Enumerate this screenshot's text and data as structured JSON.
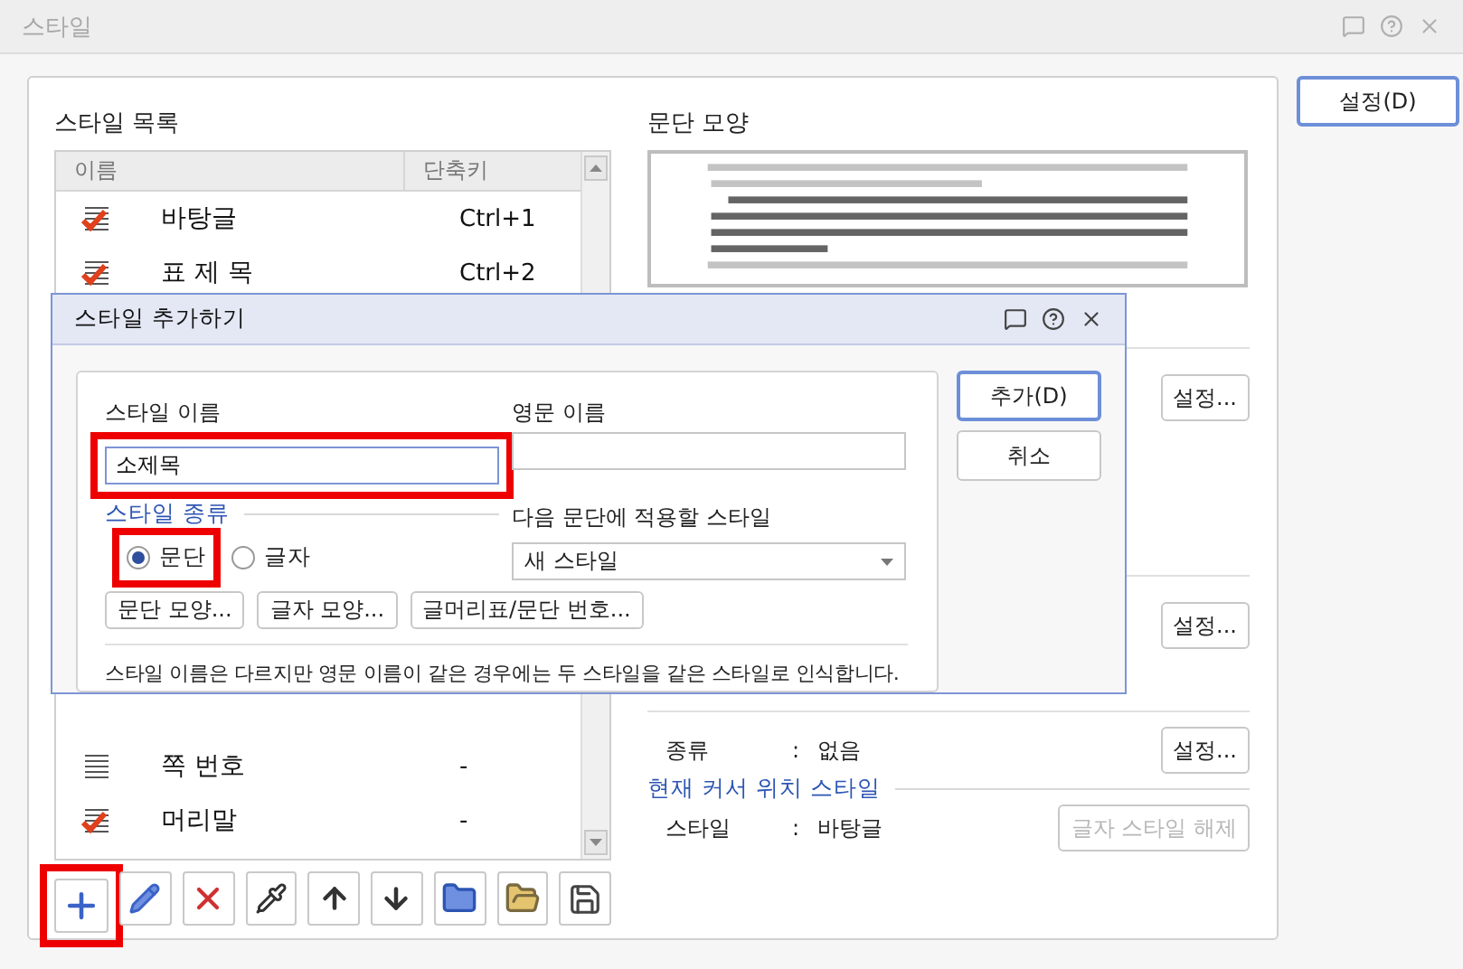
{
  "window": {
    "title": "스타일",
    "setup_button": "설정(D)"
  },
  "style_list": {
    "title": "스타일 목록",
    "columns": [
      "이름",
      "단축키"
    ],
    "rows": [
      {
        "kind": "paragraph",
        "name": "바탕글",
        "shortcut": "Ctrl+1"
      },
      {
        "kind": "paragraph",
        "name": "표 제 목",
        "shortcut": "Ctrl+2"
      }
    ],
    "rows_lower": [
      {
        "kind": "character",
        "name": "쪽 번호",
        "shortcut": "-"
      },
      {
        "kind": "paragraph",
        "name": "머리말",
        "shortcut": "-"
      }
    ]
  },
  "toolbar": [
    {
      "kind": "add",
      "highlighted": true
    },
    {
      "kind": "edit",
      "highlighted": false
    },
    {
      "kind": "delete",
      "highlighted": false
    },
    {
      "kind": "picker",
      "highlighted": false
    },
    {
      "kind": "up",
      "highlighted": false
    },
    {
      "kind": "down",
      "highlighted": false
    },
    {
      "kind": "import",
      "highlighted": false
    },
    {
      "kind": "open",
      "highlighted": false
    },
    {
      "kind": "save",
      "highlighted": false
    }
  ],
  "paragraph_shape": {
    "title": "문단 모양"
  },
  "side_buttons": [
    "설정...",
    "설정..."
  ],
  "numbering": {
    "rows": [
      {
        "label": "종류",
        "separator": ":",
        "value": "없음"
      }
    ],
    "button": "설정..."
  },
  "cursor_style": {
    "title": "현재 커서 위치 스타일",
    "rows": [
      {
        "label": "스타일",
        "separator": ":",
        "value": "바탕글"
      }
    ],
    "button": {
      "label": "글자 스타일 해제",
      "disabled": true
    }
  },
  "dialog": {
    "title": "스타일 추가하기",
    "name_label": "스타일 이름",
    "name_value": "소제목",
    "name_highlighted": true,
    "english_label": "영문 이름",
    "type_label": "스타일 종류",
    "types": [
      {
        "label": "문단",
        "selected": true,
        "highlighted": true
      },
      {
        "label": "글자",
        "selected": false,
        "highlighted": false
      }
    ],
    "next_label": "다음 문단에 적용할 스타일",
    "next_value": "새 스타일",
    "shape_buttons": [
      "문단 모양...",
      "글자 모양...",
      "글머리표/문단 번호..."
    ],
    "note": "스타일 이름은 다르지만 영문 이름이 같은 경우에는 두 스타일을 같은 스타일로 인식합니다.",
    "buttons": [
      "추가(D)",
      "취소"
    ]
  }
}
